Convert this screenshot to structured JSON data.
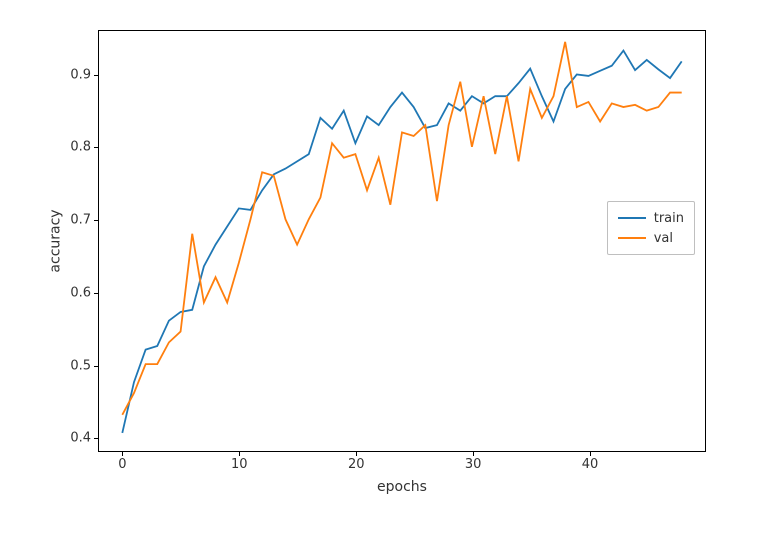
{
  "chart_data": {
    "type": "line",
    "title": "",
    "xlabel": "epochs",
    "ylabel": "accuracy",
    "xlim": [
      -2,
      50
    ],
    "ylim": [
      0.38,
      0.96
    ],
    "xticks": [
      0,
      10,
      20,
      30,
      40
    ],
    "yticks": [
      0.4,
      0.5,
      0.6,
      0.7,
      0.8,
      0.9
    ],
    "xtick_labels": [
      "0",
      "10",
      "20",
      "30",
      "40"
    ],
    "ytick_labels": [
      "0.4",
      "0.5",
      "0.6",
      "0.7",
      "0.8",
      "0.9"
    ],
    "x": [
      0,
      1,
      2,
      3,
      4,
      5,
      6,
      7,
      8,
      9,
      10,
      11,
      12,
      13,
      14,
      15,
      16,
      17,
      18,
      19,
      20,
      21,
      22,
      23,
      24,
      25,
      26,
      27,
      28,
      29,
      30,
      31,
      32,
      33,
      34,
      35,
      36,
      37,
      38,
      39,
      40,
      41,
      42,
      43,
      44,
      45,
      46,
      47,
      48
    ],
    "series": [
      {
        "name": "train",
        "color": "#1f77b4",
        "values": [
          0.405,
          0.475,
          0.52,
          0.525,
          0.56,
          0.572,
          0.575,
          0.635,
          0.665,
          0.69,
          0.715,
          0.713,
          0.74,
          0.762,
          0.77,
          0.78,
          0.79,
          0.84,
          0.825,
          0.85,
          0.805,
          0.842,
          0.83,
          0.855,
          0.875,
          0.855,
          0.826,
          0.83,
          0.86,
          0.85,
          0.87,
          0.86,
          0.87,
          0.87,
          0.888,
          0.908,
          0.87,
          0.835,
          0.88,
          0.9,
          0.898,
          0.905,
          0.912,
          0.933,
          0.906,
          0.92,
          0.907,
          0.895,
          0.918
        ]
      },
      {
        "name": "val",
        "color": "#ff7f0e",
        "values": [
          0.43,
          0.46,
          0.5,
          0.5,
          0.53,
          0.545,
          0.68,
          0.585,
          0.62,
          0.585,
          0.64,
          0.7,
          0.765,
          0.76,
          0.7,
          0.665,
          0.7,
          0.73,
          0.805,
          0.785,
          0.79,
          0.74,
          0.785,
          0.72,
          0.82,
          0.815,
          0.83,
          0.725,
          0.83,
          0.89,
          0.8,
          0.87,
          0.79,
          0.87,
          0.78,
          0.88,
          0.84,
          0.87,
          0.945,
          0.855,
          0.862,
          0.835,
          0.86,
          0.855,
          0.858,
          0.85,
          0.855,
          0.875,
          0.875
        ]
      }
    ],
    "legend": {
      "position": "right-center",
      "entries": [
        "train",
        "val"
      ]
    }
  }
}
